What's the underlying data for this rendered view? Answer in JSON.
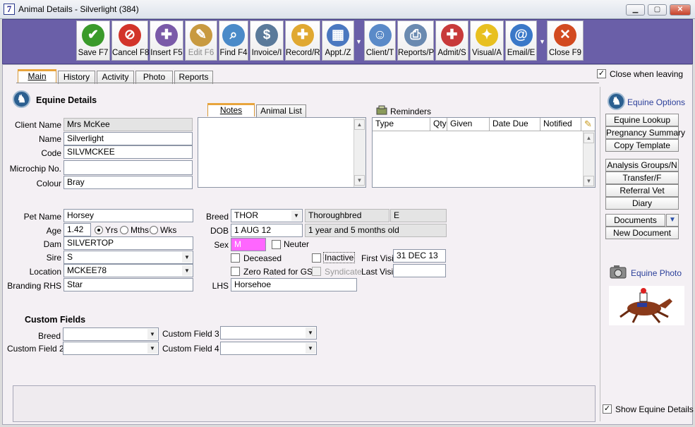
{
  "window": {
    "title": "Animal Details - Silverlight (384)",
    "app_icon": "7",
    "minimize": "▁",
    "maximize": "▢",
    "close": "✕"
  },
  "toolbar": {
    "buttons": [
      {
        "label": "Save F7",
        "icon": "check-icon",
        "glyph": "✔",
        "color": "#3a9a2a"
      },
      {
        "label": "Cancel F8",
        "icon": "no-entry-icon",
        "glyph": "⊘",
        "color": "#d2342a"
      },
      {
        "label": "Insert F5",
        "icon": "insert-page-icon",
        "glyph": "✚",
        "color": "#7a5aa8"
      },
      {
        "label": "Edit F6",
        "icon": "edit-page-icon",
        "glyph": "✎",
        "color": "#c89a40"
      },
      {
        "label": "Find F4",
        "icon": "magnifier-icon",
        "glyph": "⌕",
        "color": "#4a8ac8"
      },
      {
        "label": "Invoice/I",
        "icon": "invoice-icon",
        "glyph": "$",
        "color": "#5a7a9a"
      },
      {
        "label": "Record/R",
        "icon": "folder-add-icon",
        "glyph": "✚",
        "color": "#e0a830"
      },
      {
        "label": "Appt./Z",
        "icon": "calendar-icon",
        "glyph": "▦",
        "color": "#4a78c0"
      },
      {
        "label": "Client/T",
        "icon": "person-icon",
        "glyph": "☺",
        "color": "#5a8ac8"
      },
      {
        "label": "Reports/P",
        "icon": "printer-icon",
        "glyph": "⎙",
        "color": "#6a8ab0"
      },
      {
        "label": "Admit/S",
        "icon": "admit-animal-icon",
        "glyph": "✚",
        "color": "#c83a3a"
      },
      {
        "label": "Visual/A",
        "icon": "lightbulb-icon",
        "glyph": "✦",
        "color": "#e8c020"
      },
      {
        "label": "Email/E",
        "icon": "email-at-icon",
        "glyph": "@",
        "color": "#3a78c8"
      },
      {
        "label": "Close F9",
        "icon": "close-x-icon",
        "glyph": "✕",
        "color": "#d24a20"
      }
    ]
  },
  "tabs": [
    "Main",
    "History",
    "Activity",
    "Photo",
    "Reports"
  ],
  "close_when_leaving": {
    "label": "Close when leaving",
    "checked": true
  },
  "section_title": "Equine Details",
  "client": {
    "labels": {
      "client_name": "Client Name",
      "name": "Name",
      "code": "Code",
      "microchip": "Microchip No.",
      "colour": "Colour"
    },
    "values": {
      "client_name": "Mrs McKee",
      "name": "Silverlight",
      "code": "SILVMCKEE",
      "microchip": "",
      "colour": "Bray"
    }
  },
  "notes_tabs": [
    "Notes",
    "Animal List"
  ],
  "reminders": {
    "title": "Reminders",
    "columns": [
      "Type",
      "Qty",
      "Given",
      "Date Due",
      "Notified"
    ]
  },
  "pet": {
    "labels": {
      "pet_name": "Pet Name",
      "age": "Age",
      "dam": "Dam",
      "sire": "Sire",
      "location": "Location",
      "branding": "Branding RHS"
    },
    "values": {
      "pet_name": "Horsey",
      "age": "1.42",
      "dam": "SILVERTOP",
      "sire": "S",
      "location": "MCKEE78",
      "branding": "Star"
    },
    "age_units": [
      {
        "label": "Yrs",
        "selected": true
      },
      {
        "label": "Mths",
        "selected": false
      },
      {
        "label": "Wks",
        "selected": false
      }
    ]
  },
  "breed": {
    "labels": {
      "breed": "Breed",
      "dob": "DOB",
      "sex": "Sex",
      "lhs": "LHS"
    },
    "breed_code": "THOR",
    "breed_name": "Thoroughbred",
    "breed_class": "E",
    "dob": "1 AUG 12",
    "age_text": "1 year and 5 months old",
    "sex": "M",
    "sex_color": "#ff66ff",
    "neuter": "Neuter",
    "deceased": "Deceased",
    "inactive": "Inactive",
    "zero_rated": "Zero Rated for GST",
    "syndicate": "Syndicate",
    "first_visit_label": "First Visit",
    "first_visit": "31 DEC 13",
    "last_visit_label": "Last Visit",
    "last_visit": "",
    "lhs": "Horsehoe"
  },
  "custom": {
    "title": "Custom Fields",
    "labels": {
      "breed": "Breed",
      "field2": "Custom Field 2",
      "field3": "Custom Field 3",
      "field4": "Custom Field 4"
    }
  },
  "sidebar": {
    "options_title": "Equine Options",
    "buttons_top": [
      "Equine Lookup",
      "Pregnancy Summary",
      "Copy Template"
    ],
    "buttons_mid": [
      "Analysis Groups/N",
      "Transfer/F",
      "Referral Vet",
      "Diary"
    ],
    "documents": "Documents",
    "new_document": "New Document",
    "photo_title": "Equine Photo",
    "show_details": {
      "label": "Show Equine Details",
      "checked": true
    }
  },
  "colors": {
    "toolbar_bg": "#6a5fa8",
    "tab_accent": "#e8a53d",
    "sex_highlight": "#ff66ff",
    "option_title": "#2b3f9a"
  }
}
